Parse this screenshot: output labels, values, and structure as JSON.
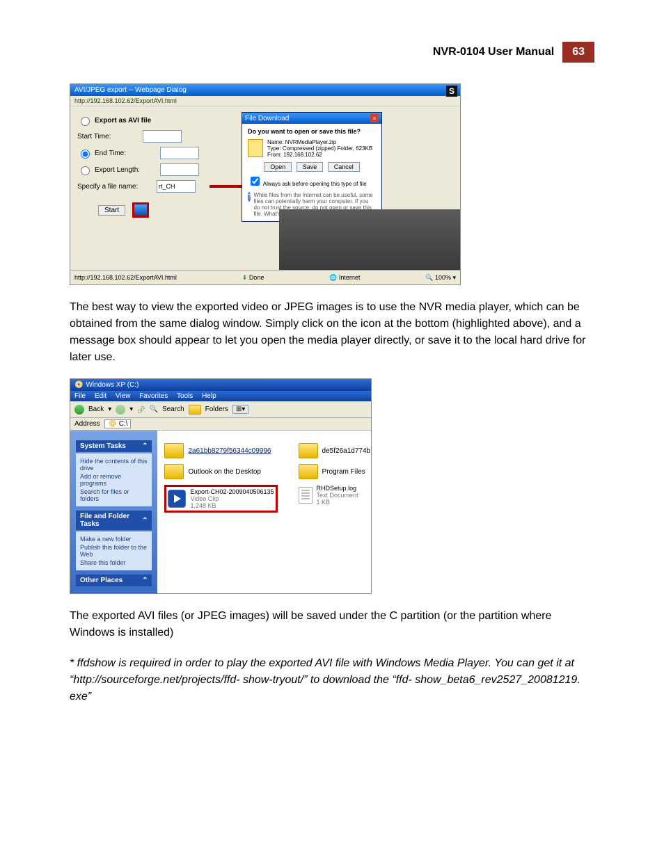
{
  "header": {
    "title": "NVR-0104 User Manual",
    "page": "63"
  },
  "shot1": {
    "title": "AVI/JPEG export -- Webpage Dialog",
    "address": "http://192.168.102.62/ExportAVI.html",
    "export_as": "Export as AVI file",
    "start_time": "Start Time:",
    "end_time": "End Time:",
    "export_length": "Export Length:",
    "specify_file": "Specify a file name:",
    "file_value": "rt_CH",
    "start_btn": "Start",
    "file_download": {
      "title": "File Download",
      "question": "Do you want to open or save this file?",
      "name_label": "Name:",
      "name_value": "NVRMediaPlayer.zip",
      "type_label": "Type:",
      "type_value": "Compressed (zipped) Folder, 623KB",
      "from_label": "From:",
      "from_value": "192.168.102.62",
      "open": "Open",
      "save": "Save",
      "cancel": "Cancel",
      "always_ask": "Always ask before opening this type of file",
      "warning": "While files from the Internet can be useful, some files can potentially harm your computer. If you do not trust the source, do not open or save this file. What's the risk?"
    },
    "statusbar": {
      "url": "http://192.168.102.62/ExportAVI.html",
      "done": "Done",
      "zone": "Internet",
      "zoom": "100%"
    },
    "s_badge": "S"
  },
  "para1": "The best way to view the exported video or JPEG images is to use the NVR media player, which can be obtained from the same dialog window. Simply click on the icon at the bottom (highlighted above), and a message box should appear to let you open the media player directly, or save it to the local hard drive for later use.",
  "shot2": {
    "title": "Windows XP (C:)",
    "menu": [
      "File",
      "Edit",
      "View",
      "Favorites",
      "Tools",
      "Help"
    ],
    "toolbar": {
      "back": "Back",
      "search": "Search",
      "folders": "Folders"
    },
    "address_label": "Address",
    "address_value": "C:\\",
    "side": {
      "system_tasks": "System Tasks",
      "system_items": [
        "Hide the contents of this drive",
        "Add or remove programs",
        "Search for files or folders"
      ],
      "file_tasks": "File and Folder Tasks",
      "file_items": [
        "Make a new folder",
        "Publish this folder to the Web",
        "Share this folder"
      ],
      "other_places": "Other Places"
    },
    "files": {
      "f1": "2a61bb8279f56344c09996",
      "f2": "de5f26a1d774b",
      "f3": "Outlook on the Desktop",
      "f4": "Program Files",
      "video_name": "Export-CH02-2009040506135",
      "video_type": "Video Clip",
      "video_size": "1,248 KB",
      "log_name": "RHDSetup.log",
      "log_type": "Text Document",
      "log_size": "1 KB"
    }
  },
  "para2": "The exported AVI files (or JPEG images) will be saved under the C partition (or the partition where Windows is installed)",
  "footnote": "* ffdshow is required in order to play the exported AVI file with Windows Media Player. You can get it at “http://sourceforge.net/projects/ffd- show-tryout/” to download the “ffd- show_beta6_rev2527_20081219. exe”"
}
